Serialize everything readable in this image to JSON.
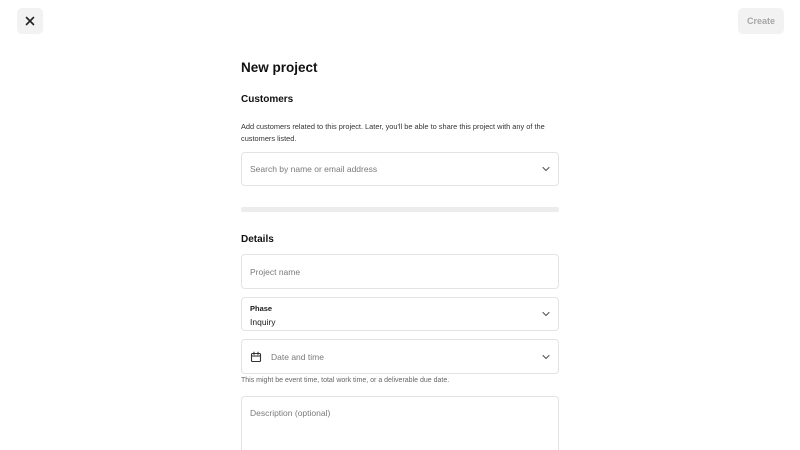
{
  "header": {
    "close_icon": "close-icon",
    "create_label": "Create"
  },
  "form": {
    "title": "New project",
    "customers": {
      "heading": "Customers",
      "description": "Add customers related to this project. Later, you'll be able to share this project with any of the customers listed.",
      "search_placeholder": "Search by name or email address",
      "search_icon": "chevron-down-icon"
    },
    "details": {
      "heading": "Details",
      "project_name_placeholder": "Project name",
      "phase_label": "Phase",
      "phase_value": "Inquiry",
      "date_placeholder": "Date and time",
      "date_icon": "calendar-icon",
      "date_help": "This might be event time, total work time, or a deliverable due date.",
      "description_placeholder": "Description (optional)"
    }
  },
  "colors": {
    "button_bg": "#f2f2f2",
    "disabled_text": "#a6a6a6",
    "border": "#e3e3e3"
  }
}
